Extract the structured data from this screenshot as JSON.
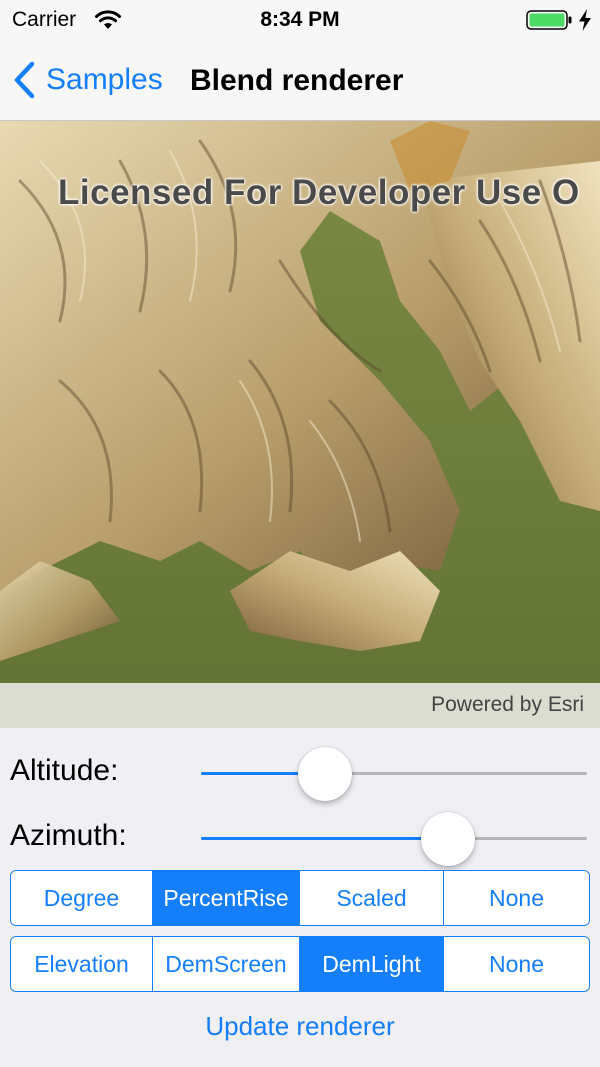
{
  "status_bar": {
    "carrier": "Carrier",
    "time": "8:34 PM",
    "wifi_icon": "wifi-icon",
    "battery_icon": "battery-icon",
    "charging_icon": "charging-bolt-icon",
    "battery_color": "#4cd964"
  },
  "nav": {
    "back_label": "Samples",
    "title": "Blend renderer",
    "accent_color": "#157efb"
  },
  "map": {
    "watermark": "Licensed For Developer Use O",
    "attribution": "Powered by Esri"
  },
  "controls": {
    "altitude": {
      "label": "Altitude:",
      "value_fraction": 0.32
    },
    "azimuth": {
      "label": "Azimuth:",
      "value_fraction": 0.64
    },
    "slope_type": {
      "options": [
        "Degree",
        "PercentRise",
        "Scaled",
        "None"
      ],
      "selected": "PercentRise"
    },
    "color_ramp": {
      "options": [
        "Elevation",
        "DemScreen",
        "DemLight",
        "None"
      ],
      "selected": "DemLight"
    },
    "update_label": "Update renderer"
  }
}
